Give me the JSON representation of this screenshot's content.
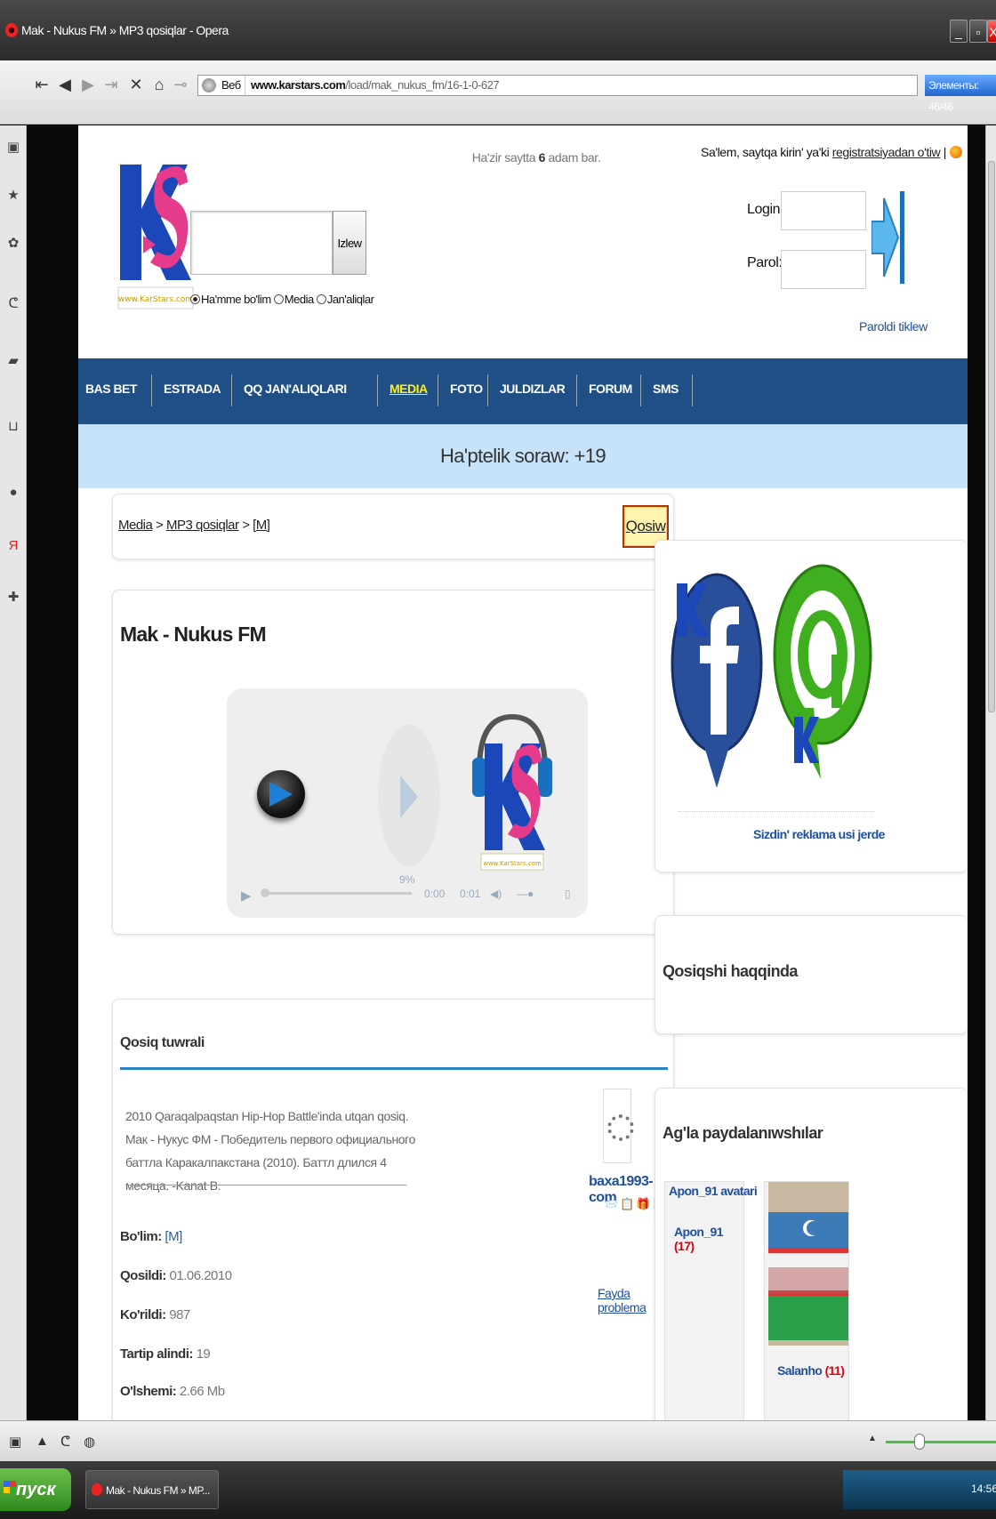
{
  "window": {
    "title": "Mak - Nukus FM » MP3 qosiqlar - Opera",
    "buttons": {
      "minimize": "_",
      "maximize": "▫",
      "close": "X"
    }
  },
  "toolbar": {
    "address_prefix": "Веб",
    "url_host": "www.karstars.com",
    "url_path": "/load/mak_nukus_fm/16-1-0-627",
    "elements_badge": "Элементы: 46/46"
  },
  "site": {
    "online_prefix": "Ha'zir saytta ",
    "online_count": "6",
    "online_suffix": " adam bar.",
    "search_button": "Izlew",
    "search_options": [
      "Ha'mme bo'lim",
      "Media",
      "Jan'aliqlar"
    ],
    "greeting_prefix": "Sa'lem, saytqa kirin' ya'ki ",
    "greeting_link": "registratsiyadan o'tiw",
    "greeting_suffix": " |",
    "login_label": "Login:",
    "password_label": "Parol:",
    "reset_link": "Paroldi tiklew",
    "logo_text": "www.KarStars.com"
  },
  "nav": {
    "items": [
      {
        "label": "BAS BET",
        "active": false
      },
      {
        "label": "ESTRADA",
        "active": false
      },
      {
        "label": "QQ JAN'ALIQLARI",
        "active": false
      },
      {
        "label": "MEDIA",
        "active": true
      },
      {
        "label": "FOTO",
        "active": false
      },
      {
        "label": "JULDIZLAR",
        "active": false
      },
      {
        "label": "FORUM",
        "active": false
      },
      {
        "label": "SMS",
        "active": false
      }
    ]
  },
  "poll": {
    "text": "Ha'ptelik soraw: +19"
  },
  "breadcrumb": {
    "media": "Media",
    "sep": ">",
    "mp3": "MP3 qosiqlar",
    "letter": "[M]",
    "add_button": "Qosiw"
  },
  "song": {
    "title": "Mak - Nukus FM",
    "player": {
      "progress_label": "9%",
      "time_current": "0:00",
      "time_total": "0:01"
    }
  },
  "details": {
    "heading": "Qosiq tuwrali",
    "description": "2010 Qaraqalpaqstan Hip-Hop Battle'inda utqan qosiq. Мак - Нукус ФМ - Победитель первого официального баттла Каракалпакстана (2010). Баттл длился 4 месяца. -Kanat B.",
    "fields": [
      {
        "label": "Bo'lim:",
        "value": "[M]",
        "link": true
      },
      {
        "label": "Qosildi:",
        "value": "01.06.2010",
        "link": false
      },
      {
        "label": "Ko'rildi:",
        "value": "987",
        "link": false
      },
      {
        "label": "Tartip alindi:",
        "value": "19",
        "link": false
      },
      {
        "label": "O'lshemi:",
        "value": "2.66 Mb",
        "link": false
      }
    ],
    "user_name": "baxa1993-com",
    "report_link": "Fayda problema"
  },
  "sidebar": {
    "ad_text": "Sizdin' reklama usi jerde",
    "about_heading": "Qosiqshi haqqinda",
    "top_heading": "Ag'la paydalanıwshılar",
    "top_users": [
      {
        "avatar_alt": "Apon_91 avatari",
        "name": "Apon_91",
        "count": "(17)"
      },
      {
        "name": "Salanho",
        "count": "(11)"
      }
    ]
  },
  "taskbar": {
    "start": "пуск",
    "task": "Mak - Nukus FM » MP...",
    "clock": "14:56"
  }
}
